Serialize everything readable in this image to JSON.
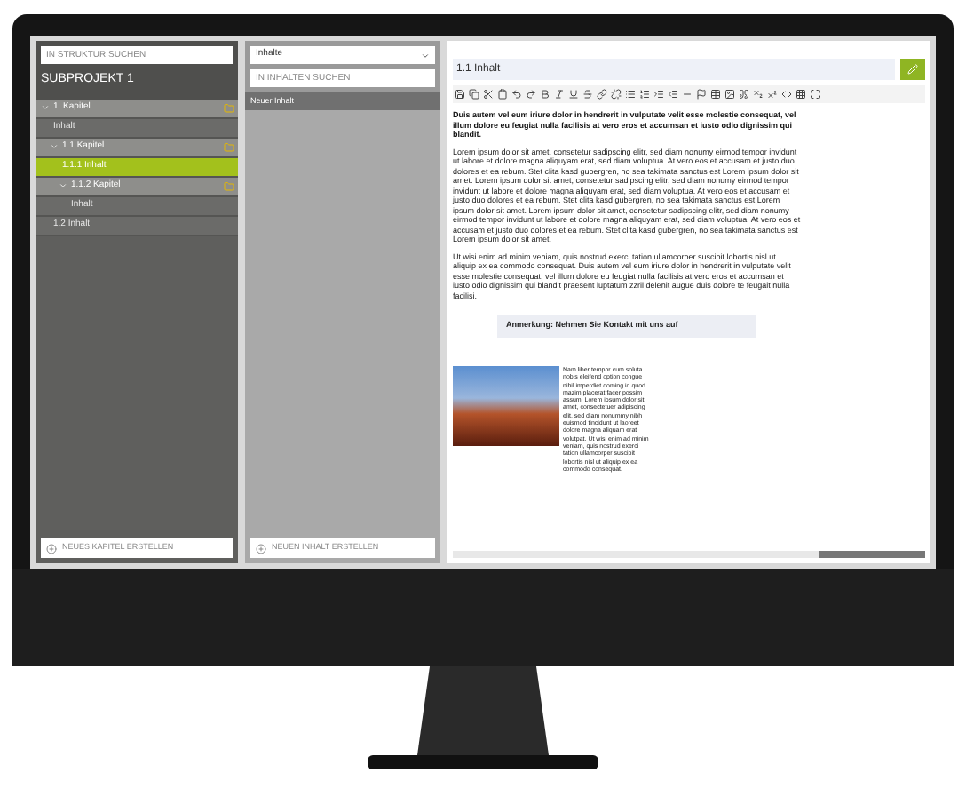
{
  "structure_search": {
    "placeholder": "IN STRUKTUR SUCHEN"
  },
  "project_title": "SUBPROJEKT 1",
  "tree": [
    {
      "kind": "chapter",
      "label": "1. Kapitel",
      "expanded": true,
      "selected": false,
      "children": [
        {
          "kind": "content",
          "label": "Inhalt",
          "selected": false
        },
        {
          "kind": "chapter",
          "label": "1.1 Kapitel",
          "expanded": true,
          "selected": false,
          "children": [
            {
              "kind": "content",
              "label": "1.1.1 Inhalt",
              "selected": true
            },
            {
              "kind": "chapter",
              "label": "1.1.2 Kapitel",
              "expanded": true,
              "selected": false,
              "children": [
                {
                  "kind": "content",
                  "label": "Inhalt",
                  "selected": false
                }
              ]
            }
          ]
        },
        {
          "kind": "content",
          "label": "1.2 Inhalt",
          "selected": false
        }
      ]
    }
  ],
  "new_chapter_button": "NEUES KAPITEL ERSTELLEN",
  "content_panel": {
    "dropdown": "Inhalte",
    "search_placeholder": "IN INHALTEN SUCHEN",
    "items": [
      {
        "label": "Neuer Inhalt"
      }
    ],
    "new_button": "NEUEN INHALT ERSTELLEN"
  },
  "editor": {
    "title": "1.1 Inhalt",
    "lead": "Duis autem vel eum iriure dolor in hendrerit in vulputate velit esse molestie consequat, vel illum dolore eu feugiat nulla facilisis at vero eros et accumsan et iusto odio dignissim qui blandit.",
    "paragraphs": [
      "Lorem ipsum dolor sit amet, consetetur sadipscing elitr, sed diam nonumy eirmod tempor invidunt ut labore et dolore magna aliquyam erat, sed diam voluptua. At vero eos et accusam et justo duo dolores et ea rebum. Stet clita kasd gubergren, no sea takimata sanctus est Lorem ipsum dolor sit amet. Lorem ipsum dolor sit amet, consetetur sadipscing elitr, sed diam nonumy eirmod tempor invidunt ut labore et dolore magna aliquyam erat, sed diam voluptua. At vero eos et accusam et justo duo dolores et ea rebum. Stet clita kasd gubergren, no sea takimata sanctus est Lorem ipsum dolor sit amet. Lorem ipsum dolor sit amet, consetetur sadipscing elitr, sed diam nonumy eirmod tempor invidunt ut labore et dolore magna aliquyam erat, sed diam voluptua. At vero eos et accusam et justo duo dolores et ea rebum. Stet clita kasd gubergren, no sea takimata sanctus est Lorem ipsum dolor sit amet.",
      "Ut wisi enim ad minim veniam, quis nostrud exerci tation ullamcorper suscipit lobortis nisl ut aliquip ex ea commodo consequat. Duis autem vel eum iriure dolor in hendrerit in vulputate velit esse molestie consequat, vel illum dolore eu feugiat nulla facilisis at vero eros et accumsan et iusto odio dignissim qui blandit praesent luptatum zzril delenit augue duis dolore te feugait nulla facilisi."
    ],
    "note": "Anmerkung: Nehmen Sie Kontakt mit uns auf",
    "image_text": "Nam liber tempor cum soluta nobis eleifend option congue nihil imperdiet doming id quod mazim placerat facer possim assum. Lorem ipsum dolor sit amet, consectetuer adipiscing elit, sed diam nonummy nibh euismod tincidunt ut laoreet dolore magna aliquam erat volutpat. Ut wisi enim ad minim veniam, quis nostrud exerci tation ullamcorper suscipit lobortis nisl ut aliquip ex ea commodo consequat."
  }
}
